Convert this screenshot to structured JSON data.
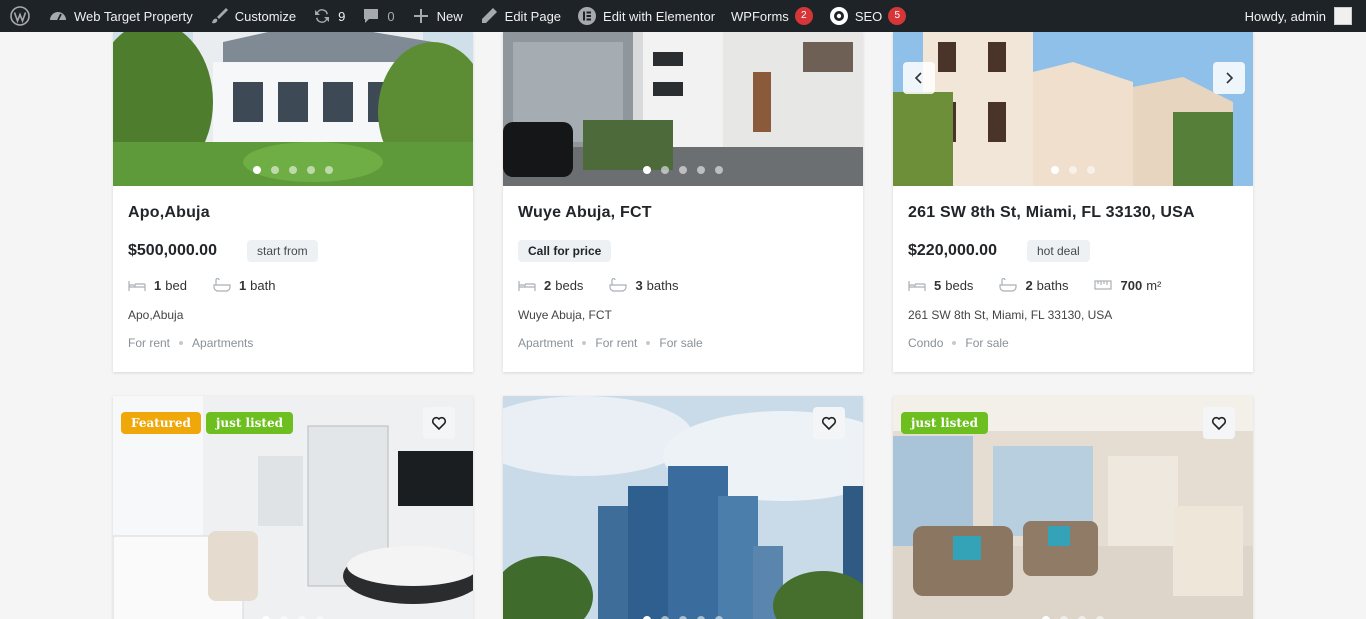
{
  "adminbar": {
    "site_name": "Web Target Property",
    "customize": "Customize",
    "updates_count": "9",
    "comments_count": "0",
    "new_label": "New",
    "edit_page": "Edit Page",
    "elementor": "Edit with Elementor",
    "wpforms": "WPForms",
    "wpforms_count": "2",
    "seo": "SEO",
    "seo_count": "5",
    "howdy": "Howdy, admin"
  },
  "listings": [
    {
      "title": "Apo,Abuja",
      "price": "$500,000.00",
      "price_tag": "start from",
      "beds_count": "1",
      "beds_label": "bed",
      "baths_count": "1",
      "baths_label": "bath",
      "address": "Apo,Abuja",
      "categories": [
        "For rent",
        "Apartments"
      ]
    },
    {
      "title": "Wuye Abuja, FCT",
      "price_tag": "Call for price",
      "beds_count": "2",
      "beds_label": "beds",
      "baths_count": "3",
      "baths_label": "baths",
      "address": "Wuye Abuja, FCT",
      "categories": [
        "Apartment",
        "For rent",
        "For sale"
      ]
    },
    {
      "title": "261 SW 8th St, Miami, FL 33130, USA",
      "price": "$220,000.00",
      "price_tag": "hot deal",
      "beds_count": "5",
      "beds_label": "beds",
      "baths_count": "2",
      "baths_label": "baths",
      "area_value": "700",
      "area_unit": "m²",
      "address": "261 SW 8th St, Miami, FL 33130, USA",
      "categories": [
        "Condo",
        "For sale"
      ]
    },
    {
      "badges": [
        "Featured",
        "just listed"
      ]
    },
    {
      "badges": []
    },
    {
      "badges": [
        "just listed"
      ]
    }
  ],
  "colors": {
    "adminbar_bg": "#1d2327",
    "badge_red": "#d63638",
    "featured": "#f0a70a",
    "just_listed": "#6cbf1f"
  }
}
